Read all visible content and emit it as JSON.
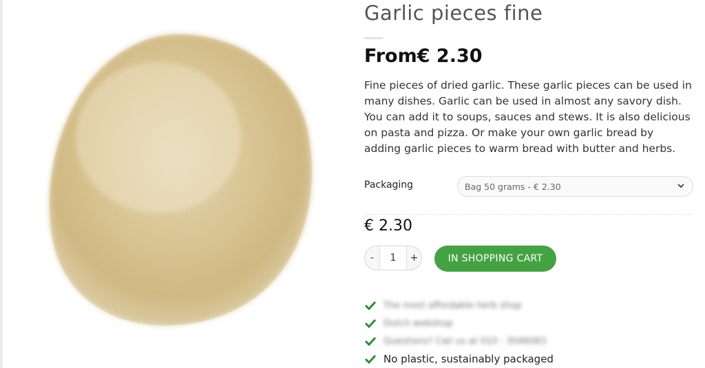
{
  "product": {
    "title": "Garlic pieces fine",
    "price_from": "From€ 2.30",
    "description": "Fine pieces of dried garlic. These garlic pieces can be used in many dishes. Garlic can be used in almost any savory dish. You can add it to soups, sauces and stews. It is also delicious on pasta and pizza. Or make your own garlic bread by adding garlic pieces to warm bread with butter and herbs.",
    "image_icon": "garlic-powder-pile"
  },
  "packaging": {
    "label": "Packaging",
    "selected": "Bag 50 grams - € 2.30"
  },
  "price_now": "€ 2.30",
  "quantity": {
    "minus": "-",
    "value": "1",
    "plus": "+"
  },
  "cart_button": "IN SHOPPING CART",
  "usps": [
    "The most affordable herb shop",
    "Dutch webshop",
    "Questions? Call us at 010 - 3046083",
    "No plastic, sustainably packaged"
  ],
  "colors": {
    "accent_green": "#45a243",
    "check_green": "#2e8b2e"
  }
}
